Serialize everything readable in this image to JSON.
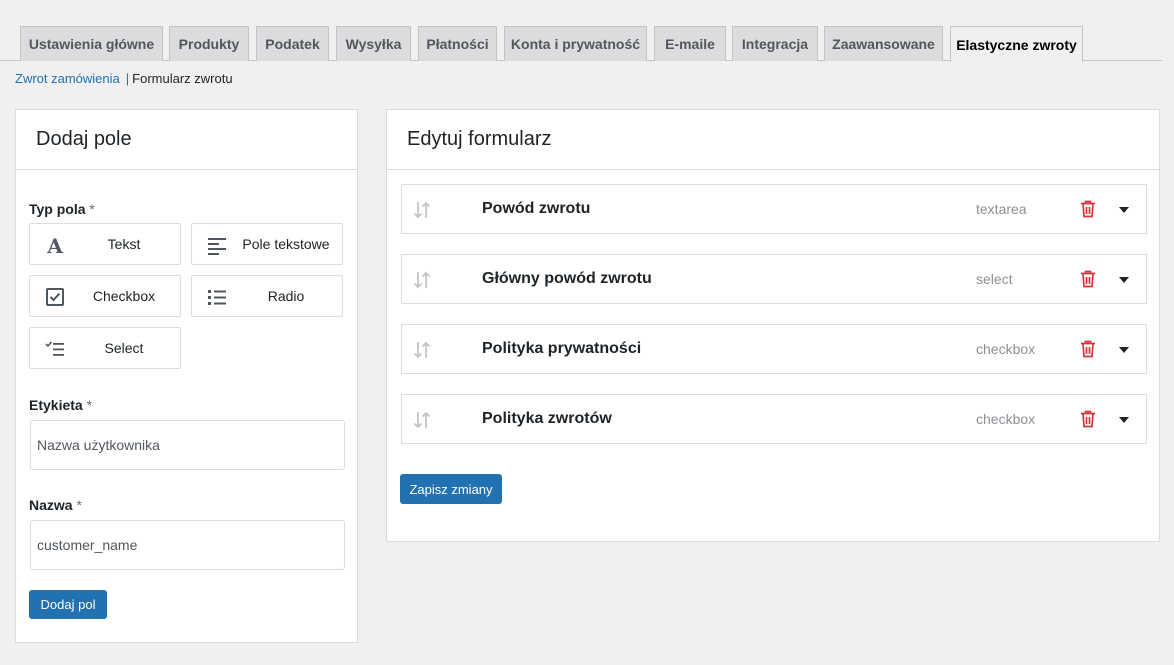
{
  "tabs": [
    {
      "label": "Ustawienia główne"
    },
    {
      "label": "Produkty"
    },
    {
      "label": "Podatek"
    },
    {
      "label": "Wysyłka"
    },
    {
      "label": "Płatności"
    },
    {
      "label": "Konta i prywatność"
    },
    {
      "label": "E-maile"
    },
    {
      "label": "Integracja"
    },
    {
      "label": "Zaawansowane"
    },
    {
      "label": "Elastyczne zwroty",
      "active": true
    }
  ],
  "breadcrumb": {
    "link": "Zwrot zamówienia",
    "separator": "|",
    "current": "Formularz zwrotu"
  },
  "add_panel": {
    "title": "Dodaj pole",
    "field_type_label": "Typ pola",
    "required_mark": "*",
    "field_types": [
      {
        "label": "Tekst",
        "icon": "text-icon"
      },
      {
        "label": "Pole tekstowe",
        "icon": "textarea-icon"
      },
      {
        "label": "Checkbox",
        "icon": "checkbox-icon"
      },
      {
        "label": "Radio",
        "icon": "radio-list-icon"
      },
      {
        "label": "Select",
        "icon": "select-list-icon"
      }
    ],
    "label_field": {
      "label": "Etykieta",
      "value": "Nazwa użytkownika"
    },
    "name_field": {
      "label": "Nazwa",
      "value": "customer_name"
    },
    "submit_label": "Dodaj pol"
  },
  "edit_panel": {
    "title": "Edytuj formularz",
    "fields": [
      {
        "title": "Powód zwrotu",
        "type": "textarea"
      },
      {
        "title": "Główny powód zwrotu",
        "type": "select"
      },
      {
        "title": "Polityka prywatności",
        "type": "checkbox"
      },
      {
        "title": "Polityka zwrotów",
        "type": "checkbox"
      }
    ],
    "save_label": "Zapisz zmiany"
  },
  "colors": {
    "primary": "#2271b1",
    "danger": "#d63638",
    "muted": "#8c8f94"
  }
}
